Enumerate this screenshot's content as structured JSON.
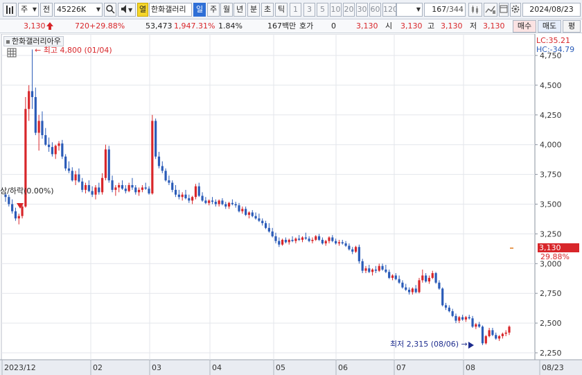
{
  "toolbar": {
    "market": "주",
    "prev_label": "전",
    "code": "45226K",
    "highlight_label": "열",
    "name": "한화갤러리",
    "periods": [
      "일",
      "주",
      "월",
      "년",
      "분",
      "초",
      "틱"
    ],
    "active_period": "일",
    "intervals": [
      "1",
      "3",
      "5",
      "10",
      "20",
      "30",
      "60",
      "120"
    ],
    "count": "167",
    "total": "/344",
    "date": "2024/08/23",
    "icons": [
      "chart-type-icon",
      "search-icon",
      "sound-icon",
      "candle-settings-icon",
      "draw-icon",
      "calendar-icon",
      "gear-icon"
    ]
  },
  "info": {
    "price": "3,130",
    "change": "720",
    "change_pct": "+29.88%",
    "volume": "53,473",
    "volume_pct": "1,947.31%",
    "turnover": "1.84%",
    "amount": "167백만",
    "quote_label": "호가",
    "quote_value": "0",
    "quote_price": "3,130",
    "open_label": "시",
    "open": "3,130",
    "high_label": "고",
    "high": "3,130",
    "low_label": "저",
    "low": "3,130",
    "buy_label": "매수",
    "sell_label": "매도",
    "eval_label": "평"
  },
  "colors": {
    "up": "#d8262a",
    "down": "#2a5bb8",
    "accent": "#2f6fd6"
  },
  "chart_data": {
    "type": "candlestick",
    "title": "한화갤러리아우",
    "y_ticks": [
      2250,
      2500,
      2750,
      3000,
      3250,
      3500,
      3750,
      4000,
      4250,
      4500,
      4750
    ],
    "y_tick_labels": [
      "2,250",
      "2,500",
      "2,750",
      "3,000",
      "3,250",
      "3,500",
      "3,750",
      "4,000",
      "4,250",
      "4,500",
      "4,750"
    ],
    "x_labels": [
      "2023/12",
      "02",
      "03",
      "04",
      "05",
      "06",
      "07",
      "08",
      "08/23"
    ],
    "annotations": {
      "max_label": "최고 4,800 (01/04)",
      "min_label": "최저 2,315 (08/06)",
      "limit_label": "상/하락(0.00%)",
      "lc_label": "LC:35.21",
      "hc_label": "HC:-34.79",
      "last_price": "3,130",
      "last_pct": "29.88%"
    },
    "ylim": [
      2200,
      4800
    ],
    "candles": [
      [
        3580,
        3600,
        3520,
        3560
      ],
      [
        3560,
        3580,
        3480,
        3500
      ],
      [
        3500,
        3540,
        3420,
        3440
      ],
      [
        3440,
        3470,
        3360,
        3380
      ],
      [
        3380,
        3420,
        3330,
        3400
      ],
      [
        3400,
        3500,
        3380,
        3480
      ],
      [
        3480,
        4400,
        3470,
        4300
      ],
      [
        4300,
        4500,
        4200,
        4450
      ],
      [
        4450,
        4800,
        4300,
        4400
      ],
      [
        4400,
        4480,
        4080,
        4100
      ],
      [
        4100,
        4250,
        3950,
        4200
      ],
      [
        4200,
        4280,
        4050,
        4080
      ],
      [
        4080,
        4140,
        3990,
        4000
      ],
      [
        4000,
        4060,
        3940,
        3980
      ],
      [
        3980,
        4020,
        3900,
        3920
      ],
      [
        3920,
        4000,
        3880,
        3990
      ],
      [
        3990,
        4030,
        3950,
        4010
      ],
      [
        4010,
        4040,
        3880,
        3900
      ],
      [
        3900,
        3920,
        3780,
        3800
      ],
      [
        3800,
        3860,
        3760,
        3780
      ],
      [
        3780,
        3810,
        3690,
        3700
      ],
      [
        3700,
        3780,
        3660,
        3750
      ],
      [
        3750,
        3800,
        3680,
        3690
      ],
      [
        3690,
        3720,
        3600,
        3620
      ],
      [
        3620,
        3680,
        3590,
        3660
      ],
      [
        3660,
        3700,
        3600,
        3610
      ],
      [
        3610,
        3650,
        3560,
        3580
      ],
      [
        3580,
        3660,
        3540,
        3640
      ],
      [
        3640,
        3680,
        3580,
        3600
      ],
      [
        3600,
        3760,
        3580,
        3720
      ],
      [
        3720,
        4000,
        3700,
        3960
      ],
      [
        3960,
        3990,
        3680,
        3700
      ],
      [
        3700,
        3740,
        3600,
        3620
      ],
      [
        3620,
        3660,
        3570,
        3640
      ],
      [
        3640,
        3680,
        3600,
        3660
      ],
      [
        3660,
        3700,
        3620,
        3630
      ],
      [
        3630,
        3660,
        3590,
        3610
      ],
      [
        3610,
        3680,
        3600,
        3660
      ],
      [
        3660,
        3720,
        3620,
        3640
      ],
      [
        3640,
        3660,
        3580,
        3600
      ],
      [
        3600,
        3640,
        3570,
        3620
      ],
      [
        3620,
        3660,
        3600,
        3640
      ],
      [
        3640,
        3680,
        3620,
        3630
      ],
      [
        3630,
        3650,
        3580,
        3590
      ],
      [
        3590,
        4250,
        3580,
        4200
      ],
      [
        4200,
        4220,
        3880,
        3900
      ],
      [
        3900,
        3940,
        3800,
        3820
      ],
      [
        3820,
        3860,
        3760,
        3780
      ],
      [
        3780,
        3800,
        3690,
        3700
      ],
      [
        3700,
        3740,
        3660,
        3680
      ],
      [
        3680,
        3700,
        3600,
        3620
      ],
      [
        3620,
        3660,
        3560,
        3580
      ],
      [
        3580,
        3620,
        3540,
        3560
      ],
      [
        3560,
        3600,
        3530,
        3580
      ],
      [
        3580,
        3620,
        3540,
        3550
      ],
      [
        3550,
        3580,
        3510,
        3530
      ],
      [
        3530,
        3570,
        3500,
        3560
      ],
      [
        3560,
        3670,
        3540,
        3650
      ],
      [
        3650,
        3680,
        3560,
        3570
      ],
      [
        3570,
        3600,
        3520,
        3530
      ],
      [
        3530,
        3560,
        3500,
        3510
      ],
      [
        3510,
        3540,
        3490,
        3530
      ],
      [
        3530,
        3560,
        3500,
        3520
      ],
      [
        3520,
        3540,
        3480,
        3500
      ],
      [
        3500,
        3540,
        3480,
        3530
      ],
      [
        3530,
        3550,
        3490,
        3500
      ],
      [
        3500,
        3520,
        3460,
        3480
      ],
      [
        3480,
        3520,
        3460,
        3510
      ],
      [
        3510,
        3540,
        3490,
        3500
      ],
      [
        3500,
        3520,
        3470,
        3490
      ],
      [
        3490,
        3510,
        3430,
        3440
      ],
      [
        3440,
        3480,
        3420,
        3460
      ],
      [
        3460,
        3480,
        3400,
        3410
      ],
      [
        3410,
        3440,
        3380,
        3430
      ],
      [
        3430,
        3450,
        3390,
        3400
      ],
      [
        3400,
        3430,
        3370,
        3380
      ],
      [
        3380,
        3420,
        3350,
        3360
      ],
      [
        3360,
        3380,
        3320,
        3340
      ],
      [
        3340,
        3360,
        3290,
        3300
      ],
      [
        3300,
        3340,
        3260,
        3270
      ],
      [
        3270,
        3300,
        3220,
        3230
      ],
      [
        3230,
        3260,
        3170,
        3190
      ],
      [
        3190,
        3220,
        3140,
        3160
      ],
      [
        3160,
        3210,
        3150,
        3200
      ],
      [
        3200,
        3220,
        3170,
        3180
      ],
      [
        3180,
        3210,
        3160,
        3200
      ],
      [
        3200,
        3230,
        3180,
        3190
      ],
      [
        3190,
        3220,
        3170,
        3210
      ],
      [
        3210,
        3240,
        3190,
        3200
      ],
      [
        3200,
        3230,
        3180,
        3220
      ],
      [
        3220,
        3260,
        3200,
        3210
      ],
      [
        3210,
        3230,
        3180,
        3190
      ],
      [
        3190,
        3220,
        3170,
        3200
      ],
      [
        3200,
        3240,
        3190,
        3230
      ],
      [
        3230,
        3250,
        3190,
        3200
      ],
      [
        3200,
        3220,
        3160,
        3170
      ],
      [
        3170,
        3200,
        3150,
        3190
      ],
      [
        3190,
        3230,
        3170,
        3220
      ],
      [
        3220,
        3240,
        3180,
        3190
      ],
      [
        3190,
        3210,
        3160,
        3170
      ],
      [
        3170,
        3200,
        3150,
        3180
      ],
      [
        3180,
        3200,
        3160,
        3170
      ],
      [
        3170,
        3190,
        3140,
        3150
      ],
      [
        3150,
        3170,
        3110,
        3120
      ],
      [
        3120,
        3140,
        3080,
        3100
      ],
      [
        3100,
        3150,
        3090,
        3140
      ],
      [
        3140,
        3160,
        3000,
        3020
      ],
      [
        3020,
        3040,
        2920,
        2940
      ],
      [
        2940,
        2980,
        2920,
        2960
      ],
      [
        2960,
        2990,
        2920,
        2930
      ],
      [
        2930,
        2960,
        2900,
        2950
      ],
      [
        2950,
        2980,
        2920,
        2940
      ],
      [
        2940,
        3000,
        2930,
        2980
      ],
      [
        2980,
        3000,
        2940,
        2950
      ],
      [
        2950,
        2990,
        2920,
        2930
      ],
      [
        2930,
        2950,
        2870,
        2880
      ],
      [
        2880,
        2910,
        2860,
        2900
      ],
      [
        2900,
        2920,
        2860,
        2870
      ],
      [
        2870,
        2900,
        2830,
        2840
      ],
      [
        2840,
        2860,
        2790,
        2800
      ],
      [
        2800,
        2830,
        2770,
        2780
      ],
      [
        2780,
        2800,
        2740,
        2760
      ],
      [
        2760,
        2800,
        2740,
        2790
      ],
      [
        2790,
        2820,
        2750,
        2760
      ],
      [
        2760,
        2880,
        2750,
        2860
      ],
      [
        2860,
        2950,
        2840,
        2900
      ],
      [
        2900,
        2920,
        2840,
        2850
      ],
      [
        2850,
        2900,
        2830,
        2880
      ],
      [
        2880,
        2940,
        2870,
        2920
      ],
      [
        2920,
        2930,
        2830,
        2840
      ],
      [
        2840,
        2860,
        2780,
        2790
      ],
      [
        2790,
        2800,
        2640,
        2650
      ],
      [
        2650,
        2670,
        2610,
        2630
      ],
      [
        2630,
        2650,
        2590,
        2600
      ],
      [
        2600,
        2620,
        2550,
        2560
      ],
      [
        2560,
        2580,
        2500,
        2520
      ],
      [
        2520,
        2560,
        2500,
        2550
      ],
      [
        2550,
        2570,
        2520,
        2530
      ],
      [
        2530,
        2560,
        2510,
        2550
      ],
      [
        2550,
        2570,
        2530,
        2540
      ],
      [
        2540,
        2560,
        2460,
        2470
      ],
      [
        2470,
        2500,
        2450,
        2490
      ],
      [
        2490,
        2510,
        2460,
        2470
      ],
      [
        2470,
        2480,
        2315,
        2330
      ],
      [
        2330,
        2400,
        2320,
        2390
      ],
      [
        2390,
        2460,
        2380,
        2440
      ],
      [
        2440,
        2460,
        2390,
        2400
      ],
      [
        2400,
        2420,
        2360,
        2370
      ],
      [
        2370,
        2400,
        2350,
        2390
      ],
      [
        2390,
        2420,
        2370,
        2410
      ],
      [
        2410,
        2440,
        2390,
        2420
      ],
      [
        2420,
        2480,
        2400,
        2470
      ]
    ]
  }
}
